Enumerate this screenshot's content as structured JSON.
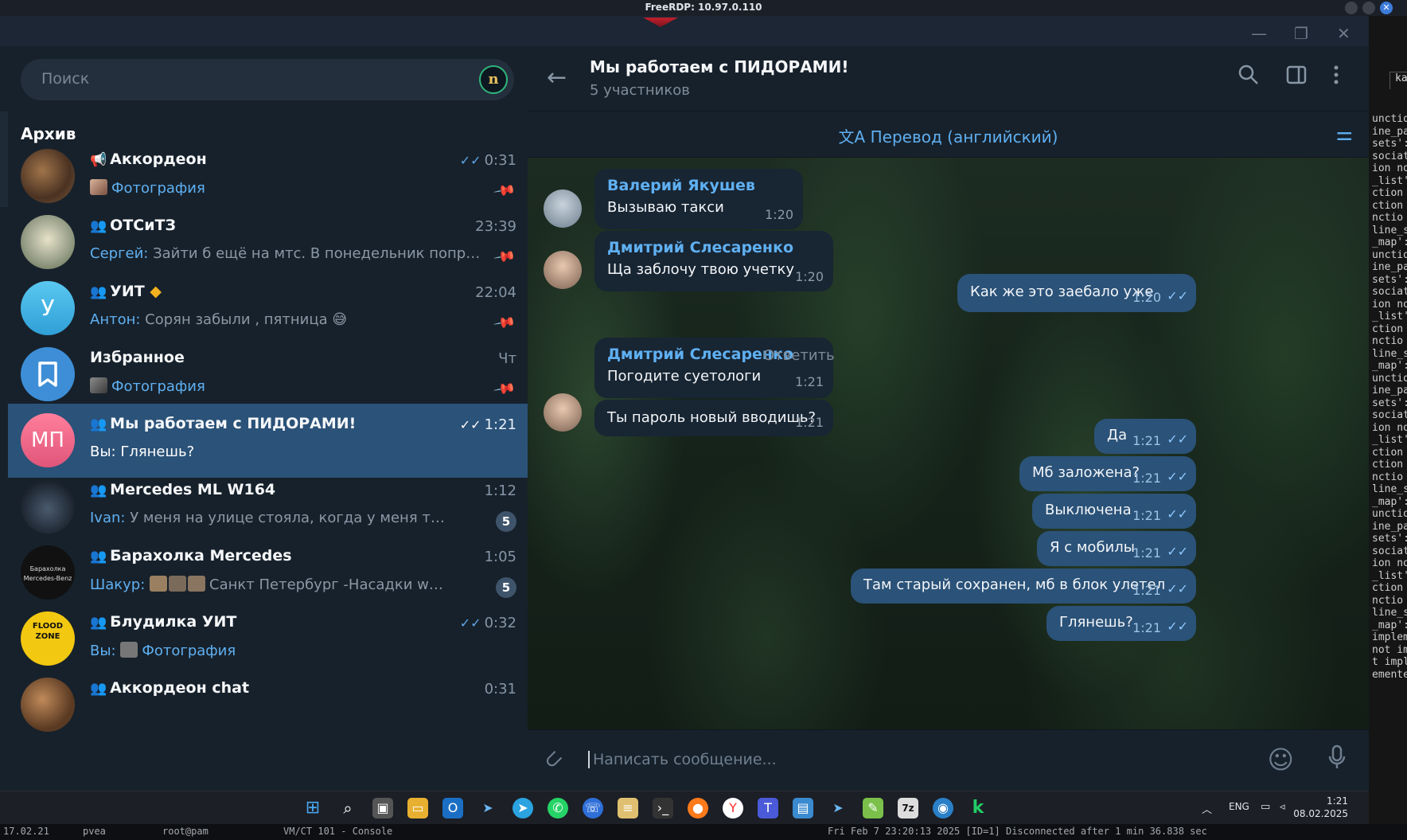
{
  "rdp": {
    "title": "FreeRDP: 10.97.0.110"
  },
  "window": {
    "minimize": "—",
    "restore": "❐",
    "close": "✕"
  },
  "sidebar": {
    "search_placeholder": "Поиск",
    "profile_badge": "n",
    "section_title": "Архив",
    "chats": [
      {
        "name": "Аккордеон",
        "prefix_icon": "megaphone-icon",
        "time": "0:31",
        "read": "✓✓",
        "msg_blue": "Фотография",
        "pinned": true
      },
      {
        "name": "ОТСиТЗ",
        "prefix_icon": "group-icon",
        "time": "23:39",
        "sender": "Сергей:",
        "msg": "Зайти б ещё на мтс. В понедельник попроб...",
        "pinned": true
      },
      {
        "name": "УИТ",
        "prefix_icon": "group-icon",
        "avatar_letter": "У",
        "time": "22:04",
        "sender": "Антон:",
        "msg": "Сорян забыли , пятница",
        "emoji": "😅",
        "pinned": true
      },
      {
        "name": "Избранное",
        "time": "Чт",
        "msg_blue": "Фотография",
        "pinned": true
      },
      {
        "name": "Мы работаем с ПИДОРАМИ!",
        "prefix_icon": "group-icon",
        "avatar_letter": "МП",
        "time": "1:21",
        "read": "✓✓",
        "msg": "Вы: Глянешь?"
      },
      {
        "name": "Mercedes ML W164",
        "prefix_icon": "group-icon",
        "time": "1:12",
        "sender": "Ivan:",
        "msg": "У меня на улице стояла, когда у меня тнвд ме...",
        "unread": "5"
      },
      {
        "name": "Барахолка Mercedes",
        "prefix_icon": "group-icon",
        "avatar_text": "Барахолка Mercedes-Benz",
        "time": "1:05",
        "sender": "Шакур:",
        "msg": "Санкт Петербург   -Насадки w219   ...",
        "unread": "5"
      },
      {
        "name": "Блудилка УИТ",
        "prefix_icon": "group-icon",
        "avatar_text": "FLOOD ZONE",
        "time": "0:32",
        "read": "✓✓",
        "sender": "Вы:",
        "msg_blue": "Фотография"
      },
      {
        "name": "Аккордеон chat",
        "prefix_icon": "group-icon",
        "time": "0:31"
      }
    ]
  },
  "chat": {
    "title": "Мы работаем с ПИДОРАМИ!",
    "subtitle": "5 участников",
    "translate_label": "Перевод (английский)",
    "input_placeholder": "Написать сообщение...",
    "messages": [
      {
        "dir": "in",
        "author": "Валерий Якушев",
        "text": "Вызываю такси",
        "time": "1:20"
      },
      {
        "dir": "in",
        "author": "Дмитрий Слесаренко",
        "text": "Ща заблочу твою учетку",
        "time": "1:20"
      },
      {
        "dir": "out",
        "text": "Как же это заебало уже",
        "time": "1:20",
        "read": "✓✓"
      },
      {
        "dir": "in",
        "author": "Дмитрий Слесаренко",
        "reply_label": "Ответить",
        "text": "Погодите суетологи",
        "time": "1:21"
      },
      {
        "dir": "in",
        "text": "Ты пароль новый вводишь?",
        "time": "1:21"
      },
      {
        "dir": "out",
        "text": "Да",
        "time": "1:21",
        "read": "✓✓"
      },
      {
        "dir": "out",
        "text": "Мб заложена?",
        "time": "1:21",
        "read": "✓✓"
      },
      {
        "dir": "out",
        "text": "Выключена",
        "time": "1:21",
        "read": "✓✓"
      },
      {
        "dir": "out",
        "text": "Я с мобилы",
        "time": "1:21",
        "read": "✓✓"
      },
      {
        "dir": "out",
        "text": "Там старый сохранен, мб в блок улетел",
        "time": "1:21",
        "read": "✓✓"
      },
      {
        "dir": "out",
        "text": "Глянешь?",
        "time": "1:21",
        "read": "✓✓"
      }
    ]
  },
  "taskbar": {
    "apps": [
      "start-icon",
      "search-icon",
      "task-view-icon",
      "file-explorer-icon",
      "outlook-icon",
      "send-icon",
      "telegram-icon",
      "whatsapp-icon",
      "viber-icon",
      "app-icon",
      "terminal-icon",
      "firefox-icon",
      "yandex-icon",
      "teams-icon",
      "rdp-icon",
      "send-icon",
      "notepad-icon",
      "7zip-icon",
      "browser-icon",
      "k-icon"
    ],
    "lang": "ENG",
    "time": "1:21",
    "date": "08.02.2025"
  },
  "terminal": {
    "tab": "ka",
    "lines": [
      "unctio",
      "ine_pa",
      "sets':",
      "sociat",
      "ion no",
      "_list'",
      "ction ",
      "ction ",
      "nctio",
      "line_s",
      "_map':",
      "unctio",
      "ine_pa",
      "sets':",
      "sociat",
      "ion no",
      "_list'",
      "ction ",
      "nctio",
      "line_s",
      "_map':",
      "unctio",
      "ine_pa",
      "sets':",
      "sociat",
      "ion no",
      "_list'",
      "ction ",
      "ction ",
      "nctio",
      "line_s",
      "_map':",
      "unctio",
      "ine_pa",
      "sets':",
      "sociat",
      "ion no",
      "_list'",
      "ction ",
      "nctio",
      "line_s",
      "_map':",
      "implem",
      "not im",
      "t impl",
      "emente"
    ]
  },
  "status_bar": {
    "items": [
      "17.02.21",
      "pvea",
      "root@pam",
      "VM/CT 101 - Console",
      "Fri Feb  7 23:20:13 2025 [ID=1] Disconnected after  1 min 36.838 sec"
    ]
  }
}
